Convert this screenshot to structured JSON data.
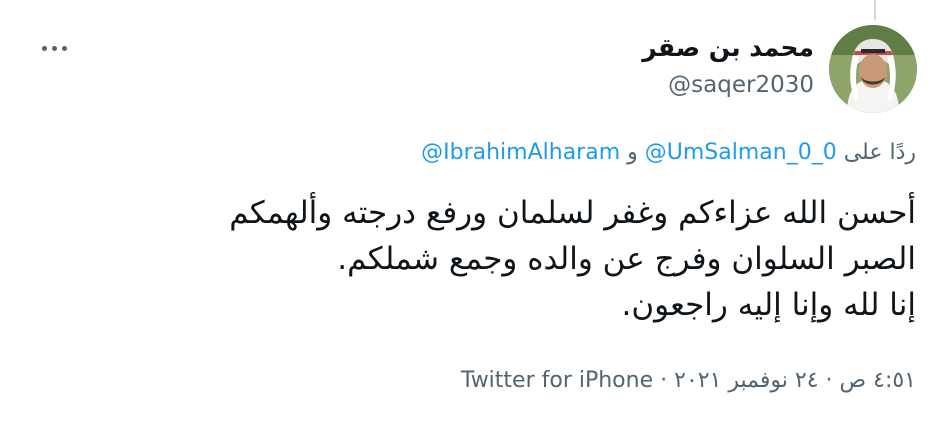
{
  "tweet": {
    "author": {
      "name": "محمد بن صقر",
      "handle": "@saqer2030"
    },
    "reply": {
      "prefix": "ردًا على",
      "mention_1": "@UmSalman_0_0",
      "conjunction": "و",
      "mention_2": "@IbrahimAlharam"
    },
    "text_lines": [
      "أحسن الله عزاءكم وغفر لسلمان ورفع درجته وألهمكم",
      "الصبر السلوان وفرج عن والده وجمع شملكم.",
      "إنا لله وإنا إليه راجعون."
    ],
    "meta": {
      "time": "٤:٥١ ص",
      "sep_1": "·",
      "date": "٢٤ نوفمبر ٢٠٢١",
      "sep_2": "·",
      "source": "Twitter for iPhone"
    },
    "icons": {
      "more": "more-horizontal-icon"
    },
    "colors": {
      "link": "#1d9bf0",
      "secondary_text": "#536471",
      "primary_text": "#0f1419"
    }
  }
}
